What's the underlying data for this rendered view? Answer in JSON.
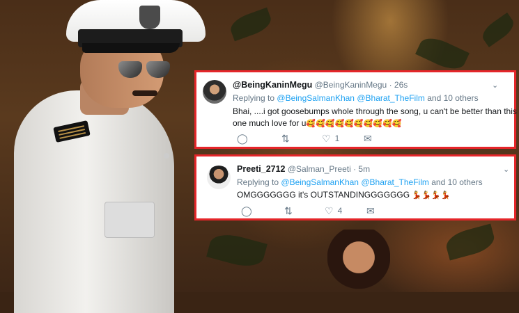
{
  "tweets": [
    {
      "display_name": "@BeingKaninMegu",
      "handle": "@BeingKaninMegu",
      "time": "· 26s",
      "replying_prefix": "Replying to",
      "reply_mention_1": "@BeingSalmanKhan",
      "reply_mention_2": "@Bharat_TheFilm",
      "reply_suffix": "and 10 others",
      "text_line_1": "Bhai, ....i got goosebumps whole through the song, u can't be better than this",
      "text_line_2": "one much love for u",
      "emojis": "🥰🥰🥰🥰🥰🥰🥰🥰🥰🥰",
      "reply_count": "",
      "retweet_count": "",
      "like_count": "1",
      "icons": [
        "reply-icon",
        "retweet-icon",
        "heart-icon",
        "dm-icon",
        "chevron-down-icon"
      ]
    },
    {
      "display_name": "Preeti_2712",
      "handle": "@Salman_Preeti",
      "time": "· 5m",
      "replying_prefix": "Replying to",
      "reply_mention_1": "@BeingSalmanKhan",
      "reply_mention_2": "@Bharat_TheFilm",
      "reply_suffix": "and 10 others",
      "text_line_1": "OMGGGGGGG it's OUTSTANDINGGGGGGG",
      "emojis": "💃💃💃💃",
      "reply_count": "",
      "retweet_count": "",
      "like_count": "4",
      "icons": [
        "reply-icon",
        "retweet-icon",
        "heart-icon",
        "dm-icon",
        "chevron-down-icon"
      ]
    }
  ],
  "colors": {
    "highlight_border": "#e5262a",
    "link": "#1da1f2",
    "muted": "#657786",
    "text": "#14171a"
  }
}
